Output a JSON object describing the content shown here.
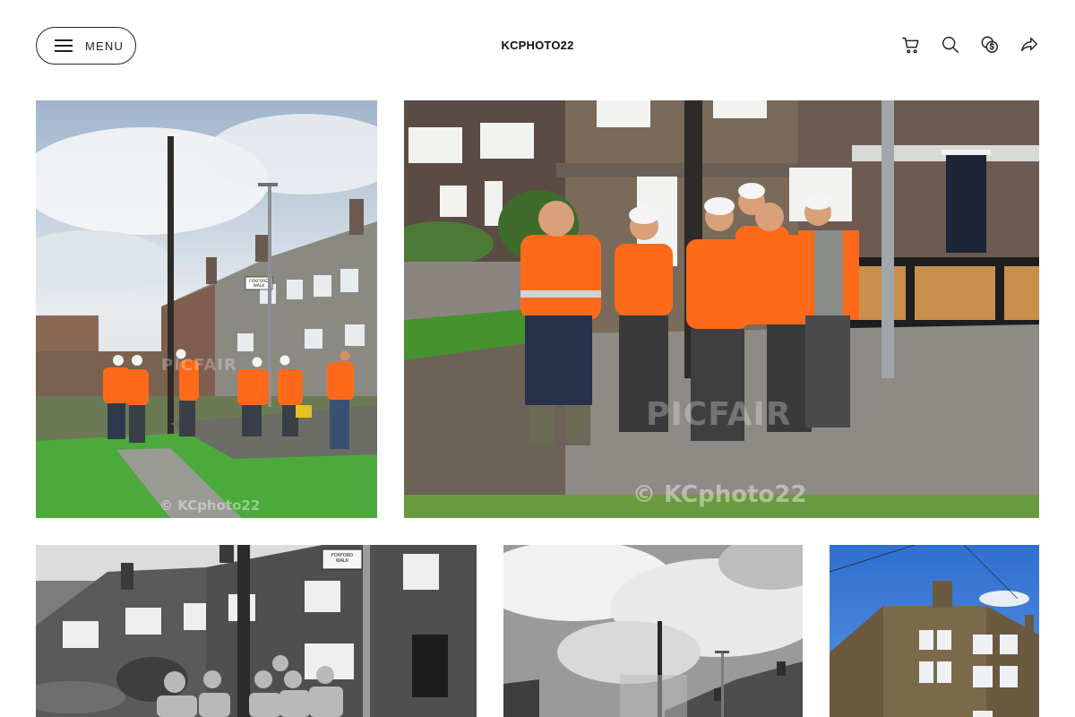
{
  "header": {
    "menu_label": "MENU",
    "brand": "KCPHOTO22",
    "icons": [
      "cart-icon",
      "search-icon",
      "currency-icon",
      "share-icon"
    ]
  },
  "gallery": {
    "photos": [
      {
        "name": "photo-workers-installing-pole",
        "watermark_brand": "PICFAIR",
        "watermark_copy": "© KCphoto22",
        "sign_text": "FOXFORD WALK",
        "tone": "color"
      },
      {
        "name": "photo-workers-group",
        "watermark_brand": "PICFAIR",
        "watermark_copy": "© KCphoto22",
        "tone": "color"
      },
      {
        "name": "photo-workers-group-bw",
        "sign_text": "FOXFORD WALK",
        "tone": "black-and-white"
      },
      {
        "name": "photo-pole-sky-bw",
        "tone": "black-and-white"
      },
      {
        "name": "photo-stone-house",
        "tone": "color"
      }
    ]
  },
  "colors": {
    "accent_hivis": "#ff6a1a",
    "sky_blue": "#3f7ed8",
    "grass": "#4caa3c",
    "brick": "#6b4f43"
  }
}
